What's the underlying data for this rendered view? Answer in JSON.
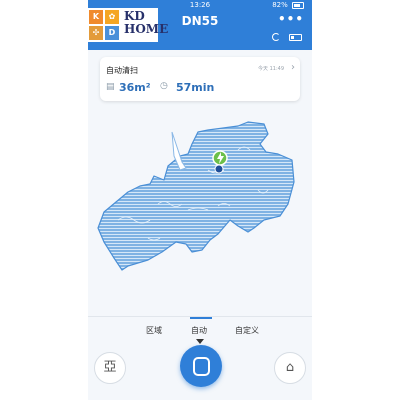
{
  "status_bar": {
    "time": "13:26",
    "battery": "82%"
  },
  "header": {
    "title": "DN55",
    "more_icon": "more-dots-icon"
  },
  "logo": {
    "letters": [
      "K",
      "D"
    ],
    "text_line1": "KD",
    "text_line2": "HOME"
  },
  "info_card": {
    "mode_title": "自动清扫",
    "time": "今天 11:49",
    "area_value": "36m²",
    "duration_value": "57min"
  },
  "mode_tabs": {
    "items": [
      "区域",
      "自动",
      "自定义"
    ],
    "selected": "自动"
  },
  "controls": {
    "left_icon": "cleaning-area-icon",
    "center_icon": "start-cleaning-icon",
    "right_icon": "dock-charger-icon"
  },
  "colors": {
    "accent": "#2f7fd8",
    "map_fill": "#7fb2e3",
    "map_lines": "#d5e7f8"
  }
}
